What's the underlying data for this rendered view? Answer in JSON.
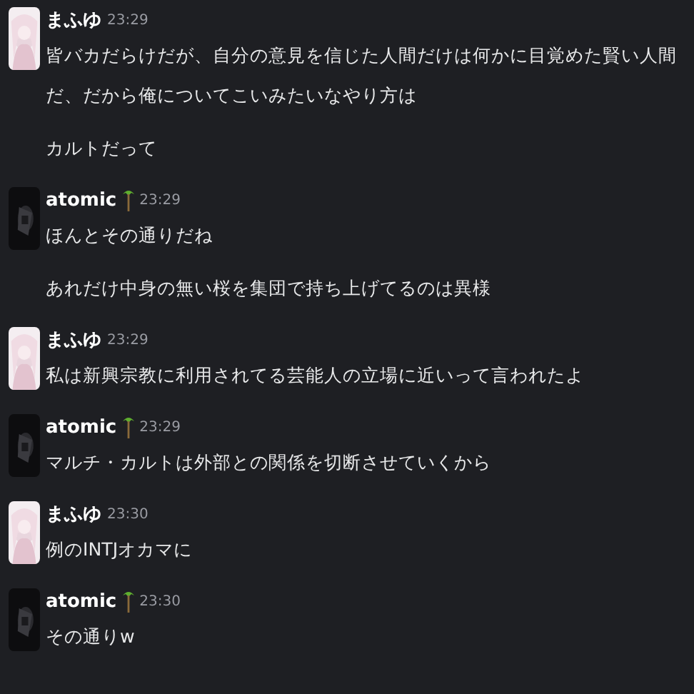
{
  "groups": [
    {
      "author": "まふゆ",
      "palm": false,
      "time": "23:29",
      "messages": [
        "皆バカだらけだが、自分の意見を信じた人間だけは何かに目覚めた賢い人間だ、だから俺についてこいみたいなやり方は",
        "カルトだって"
      ]
    },
    {
      "author": "atomic",
      "palm": true,
      "time": "23:29",
      "messages": [
        "ほんとその通りだね",
        "あれだけ中身の無い桜を集団で持ち上げてるのは異様"
      ]
    },
    {
      "author": "まふゆ",
      "palm": false,
      "time": "23:29",
      "messages": [
        "私は新興宗教に利用されてる芸能人の立場に近いって言われたよ"
      ]
    },
    {
      "author": "atomic",
      "palm": true,
      "time": "23:29",
      "messages": [
        "マルチ・カルトは外部との関係を切断させていくから"
      ]
    },
    {
      "author": "まふゆ",
      "palm": false,
      "time": "23:30",
      "messages": [
        "例のINTJオカマに"
      ]
    },
    {
      "author": "atomic",
      "palm": true,
      "time": "23:30",
      "messages": [
        "その通りw"
      ]
    }
  ]
}
